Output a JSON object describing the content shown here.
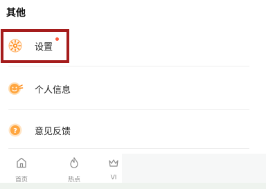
{
  "section": {
    "title": "其他"
  },
  "menu": [
    {
      "label": "设置",
      "icon": "gear-icon",
      "badge": true
    },
    {
      "label": "个人信息",
      "icon": "profile-face-icon"
    },
    {
      "label": "意见反馈",
      "icon": "question-icon"
    }
  ],
  "tabbar": {
    "tabs": [
      {
        "label": "首页",
        "icon": "home-icon"
      },
      {
        "label": "热点",
        "icon": "flame-icon"
      },
      {
        "label": "VI",
        "icon": "vip-icon"
      }
    ]
  },
  "colors": {
    "accent": "#ff8c1a",
    "highlight": "#a51c1c",
    "badge": "#ff5a3c"
  }
}
